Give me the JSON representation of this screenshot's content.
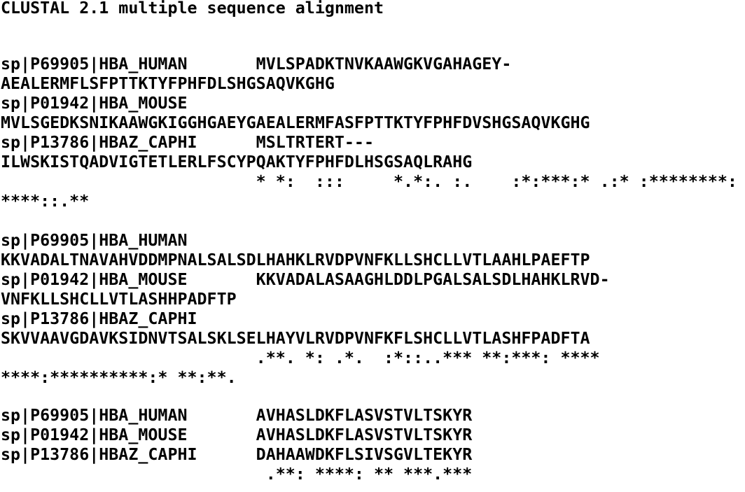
{
  "header": "CLUSTAL 2.1 multiple sequence alignment",
  "blocks": [
    {
      "lines": [
        "sp|P69905|HBA_HUMAN       MVLSPADKTNVKAAWGKVGAHAGEY-",
        "AEALERMFLSFPTTKTYFPHFDLSHGSAQVKGHG",
        "sp|P01942|HBA_MOUSE",
        "MVLSGEDKSNIKAAWGKIGGHGAEYGAEALERMFASFPTTKTYFPHFDVSHGSAQVKGHG",
        "sp|P13786|HBAZ_CAPHI      MSLTRTERT---",
        "ILWSKISTQADVIGTETLERLFSCYPQAKTYFPHFDLHSGSAQLRAHG",
        "                          * *:  :::     *.*:. :.    :*:***:* .:* :********:",
        "****::.**"
      ]
    },
    {
      "lines": [
        "sp|P69905|HBA_HUMAN",
        "KKVADALTNAVAHVDDMPNALSALSDLHAHKLRVDPVNFKLLSHCLLVTLAAHLPAEFTP",
        "sp|P01942|HBA_MOUSE       KKVADALASAAGHLDDLPGALSALSDLHAHKLRVD-",
        "VNFKLLSHCLLVTLASHHPADFTP",
        "sp|P13786|HBAZ_CAPHI",
        "SKVVAAVGDAVKSIDNVTSALSKLSELHAYVLRVDPVNFKFLSHCLLVTLASHFPADFTA",
        "                          .**. *: .*.  :*::..*** **:***: ****",
        "****:**********:* **:**."
      ]
    },
    {
      "lines": [
        "sp|P69905|HBA_HUMAN       AVHASLDKFLASVSTVLTSKYR",
        "sp|P01942|HBA_MOUSE       AVHASLDKFLASVSTVLTSKYR",
        "sp|P13786|HBAZ_CAPHI      DAHAAWDKFLSIVSGVLTEKYR",
        "                           .**: ****: ** ***.***"
      ]
    }
  ]
}
